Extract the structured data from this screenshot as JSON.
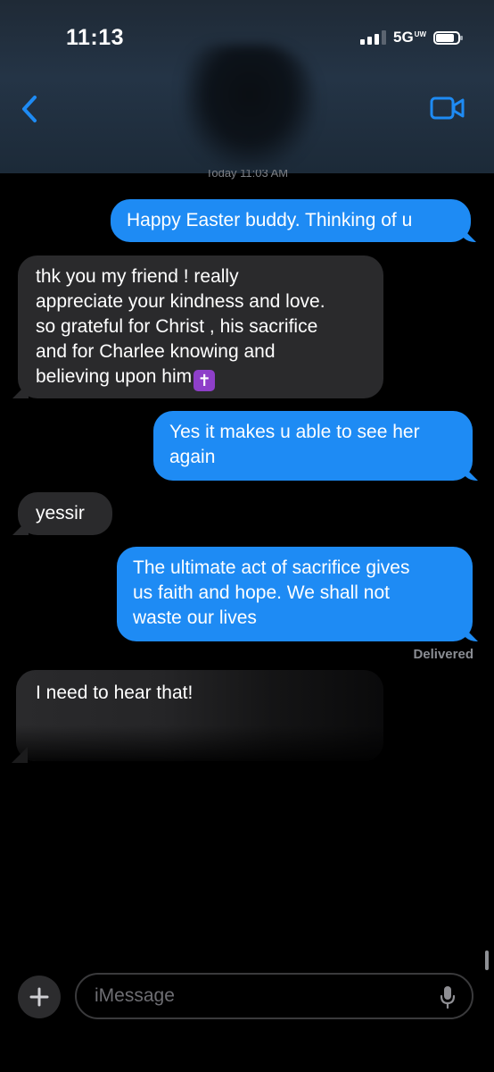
{
  "status_bar": {
    "time": "11:13",
    "network": "5G",
    "network_superscript": "UW"
  },
  "nav": {
    "back_icon": "chevron-left-icon",
    "video_icon": "video-camera-icon",
    "accent_color": "#1e8bf4"
  },
  "timestamp": "Today 11:03 AM",
  "messages": [
    {
      "direction": "outgoing",
      "text": "Happy Easter buddy. Thinking of u"
    },
    {
      "direction": "incoming",
      "lines": [
        "thk you my friend ! really",
        "appreciate your kindness and love.",
        "so grateful for Christ , his sacrifice",
        "and for Charlee knowing and",
        "believing upon him"
      ],
      "emoji": "✝"
    },
    {
      "direction": "outgoing",
      "lines": [
        "Yes it makes u able to see her",
        "again"
      ]
    },
    {
      "direction": "incoming",
      "text": "yessir"
    },
    {
      "direction": "outgoing",
      "lines": [
        "The ultimate act of sacrifice gives",
        "us faith and hope. We shall not",
        "waste our lives"
      ]
    },
    {
      "direction": "incoming",
      "text": "I need to hear that!"
    }
  ],
  "delivered_label": "Delivered",
  "composer": {
    "placeholder": "iMessage",
    "plus_icon": "plus-icon",
    "mic_icon": "microphone-icon"
  },
  "colors": {
    "outgoing_bubble": "#1e8bf4",
    "incoming_bubble": "#2a2a2c",
    "background": "#000000"
  }
}
